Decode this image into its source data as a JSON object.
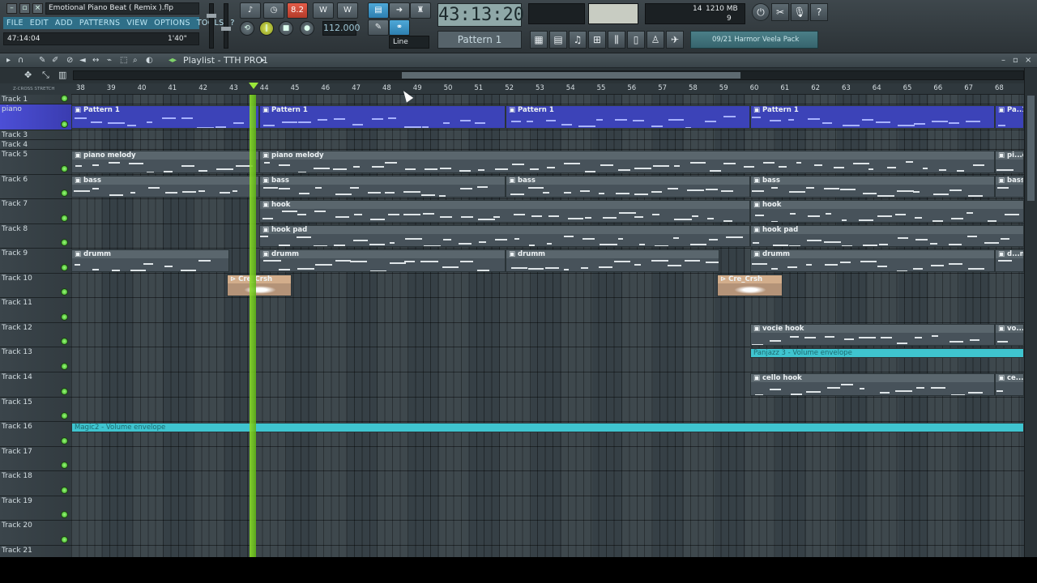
{
  "app": {
    "project_title": "Emotional Piano Beat ( Remix ).flp",
    "menu": [
      "FILE",
      "EDIT",
      "ADD",
      "PATTERNS",
      "VIEW",
      "OPTIONS",
      "TOOLS",
      "?"
    ],
    "time_left": "47:14:04",
    "time_right": "1'40\""
  },
  "transport": {
    "tempo": "112.000",
    "song_time": "43:13:20",
    "pattern": "Pattern 1",
    "snap": "Line",
    "cpu_top": "14",
    "mem": "1210 MB",
    "poly": "9",
    "rec_label": "8.2"
  },
  "browser": {
    "label": "09/21  Harmor Veela Pack"
  },
  "playlist": {
    "title": "Playlist - TTH PRO1",
    "ruler_left": "Z-CROSS  STRETCH"
  },
  "ruler": [
    "38",
    "39",
    "40",
    "41",
    "42",
    "43",
    "44",
    "45",
    "46",
    "47",
    "48",
    "49",
    "50",
    "51",
    "52",
    "53",
    "54",
    "55",
    "56",
    "57",
    "58",
    "59",
    "60",
    "61",
    "62",
    "63",
    "64",
    "65",
    "66",
    "67",
    "68"
  ],
  "tracks": [
    {
      "name": "Track 1",
      "h": 12
    },
    {
      "name": "piano",
      "h": 32,
      "selected": true
    },
    {
      "name": "Track 3",
      "h": 12
    },
    {
      "name": "Track 4",
      "h": 12
    },
    {
      "name": "Track 5",
      "h": 31
    },
    {
      "name": "Track 6",
      "h": 30
    },
    {
      "name": "Track 7",
      "h": 31
    },
    {
      "name": "Track 8",
      "h": 30
    },
    {
      "name": "Track 9",
      "h": 31
    },
    {
      "name": "Track 10",
      "h": 30
    },
    {
      "name": "Track 11",
      "h": 31
    },
    {
      "name": "Track 12",
      "h": 30
    },
    {
      "name": "Track 13",
      "h": 31
    },
    {
      "name": "Track 14",
      "h": 31
    },
    {
      "name": "Track 15",
      "h": 30
    },
    {
      "name": "Track 16",
      "h": 31
    },
    {
      "name": "Track 17",
      "h": 30
    },
    {
      "name": "Track 18",
      "h": 31
    },
    {
      "name": "Track 19",
      "h": 30
    },
    {
      "name": "Track 20",
      "h": 31
    },
    {
      "name": "Track 21",
      "h": 30
    }
  ],
  "clips": [
    {
      "track": 1,
      "label": "Pattern 1",
      "kind": "piano",
      "start": 0,
      "end": 232
    },
    {
      "track": 1,
      "label": "Pattern 1",
      "kind": "piano",
      "start": 232,
      "end": 536
    },
    {
      "track": 1,
      "label": "Pattern 1",
      "kind": "piano",
      "start": 536,
      "end": 838
    },
    {
      "track": 1,
      "label": "Pattern 1",
      "kind": "piano",
      "start": 838,
      "end": 1140
    },
    {
      "track": 1,
      "label": "Pa..1",
      "kind": "piano",
      "start": 1140,
      "end": 1176
    },
    {
      "track": 4,
      "label": "piano melody",
      "kind": "pat",
      "start": 0,
      "end": 232
    },
    {
      "track": 4,
      "label": "piano melody",
      "kind": "pat",
      "start": 232,
      "end": 1140
    },
    {
      "track": 4,
      "label": "pi...dy",
      "kind": "pat",
      "start": 1140,
      "end": 1176
    },
    {
      "track": 5,
      "label": "bass",
      "kind": "pat",
      "start": 0,
      "end": 232
    },
    {
      "track": 5,
      "label": "bass",
      "kind": "pat",
      "start": 232,
      "end": 536
    },
    {
      "track": 5,
      "label": "bass",
      "kind": "pat",
      "start": 536,
      "end": 838
    },
    {
      "track": 5,
      "label": "bass",
      "kind": "pat",
      "start": 838,
      "end": 1140
    },
    {
      "track": 5,
      "label": "bass",
      "kind": "pat",
      "start": 1140,
      "end": 1176
    },
    {
      "track": 6,
      "label": "hook",
      "kind": "pat",
      "start": 232,
      "end": 838
    },
    {
      "track": 6,
      "label": "hook",
      "kind": "pat",
      "start": 838,
      "end": 1176
    },
    {
      "track": 7,
      "label": "hook pad",
      "kind": "pat",
      "start": 232,
      "end": 838
    },
    {
      "track": 7,
      "label": "hook pad",
      "kind": "pat",
      "start": 838,
      "end": 1176
    },
    {
      "track": 8,
      "label": "drumm",
      "kind": "pat",
      "start": 0,
      "end": 195
    },
    {
      "track": 8,
      "label": "drumm",
      "kind": "pat",
      "start": 232,
      "end": 536
    },
    {
      "track": 8,
      "label": "drumm",
      "kind": "pat",
      "start": 536,
      "end": 800
    },
    {
      "track": 8,
      "label": "drumm",
      "kind": "pat",
      "start": 838,
      "end": 1140
    },
    {
      "track": 8,
      "label": "d...m",
      "kind": "pat",
      "start": 1140,
      "end": 1176
    },
    {
      "track": 9,
      "label": "Cre_Crsh",
      "kind": "audio",
      "start": 192,
      "end": 272
    },
    {
      "track": 9,
      "label": "Cre_Crsh",
      "kind": "audio",
      "start": 797,
      "end": 878
    },
    {
      "track": 11,
      "label": "vocie hook",
      "kind": "pat",
      "start": 838,
      "end": 1140
    },
    {
      "track": 11,
      "label": "vo...k",
      "kind": "pat",
      "start": 1140,
      "end": 1176
    },
    {
      "track": 12,
      "label": "Panjazz 3 - Volume envelope",
      "kind": "auto",
      "start": 838,
      "end": 1176
    },
    {
      "track": 13,
      "label": "cello hook",
      "kind": "pat",
      "start": 838,
      "end": 1140
    },
    {
      "track": 13,
      "label": "ce...ok",
      "kind": "pat",
      "start": 1140,
      "end": 1176
    },
    {
      "track": 15,
      "label": "Magic2 - Volume envelope",
      "kind": "auto",
      "start": 0,
      "end": 1176
    }
  ]
}
